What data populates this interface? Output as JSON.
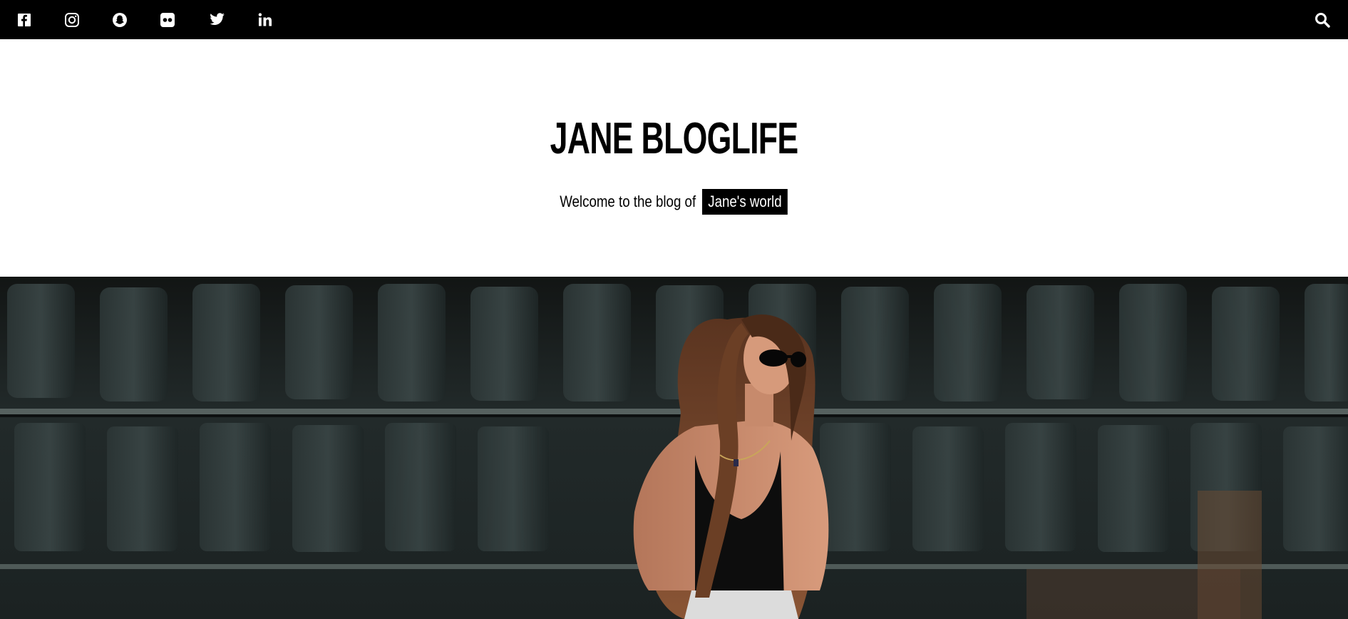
{
  "topbar": {
    "social_icons": [
      {
        "name": "facebook-icon"
      },
      {
        "name": "instagram-icon"
      },
      {
        "name": "snapchat-icon"
      },
      {
        "name": "flickr-icon"
      },
      {
        "name": "twitter-icon"
      },
      {
        "name": "linkedin-icon"
      }
    ],
    "search_icon": "search-icon"
  },
  "header": {
    "title": "JANE BLOGLIFE",
    "tagline_text": "Welcome to the blog of",
    "tagline_highlight": "Jane's world"
  },
  "colors": {
    "topbar_bg": "#000000",
    "page_bg": "#ffffff",
    "text": "#000000",
    "highlight_bg": "#000000",
    "highlight_text": "#ffffff"
  }
}
